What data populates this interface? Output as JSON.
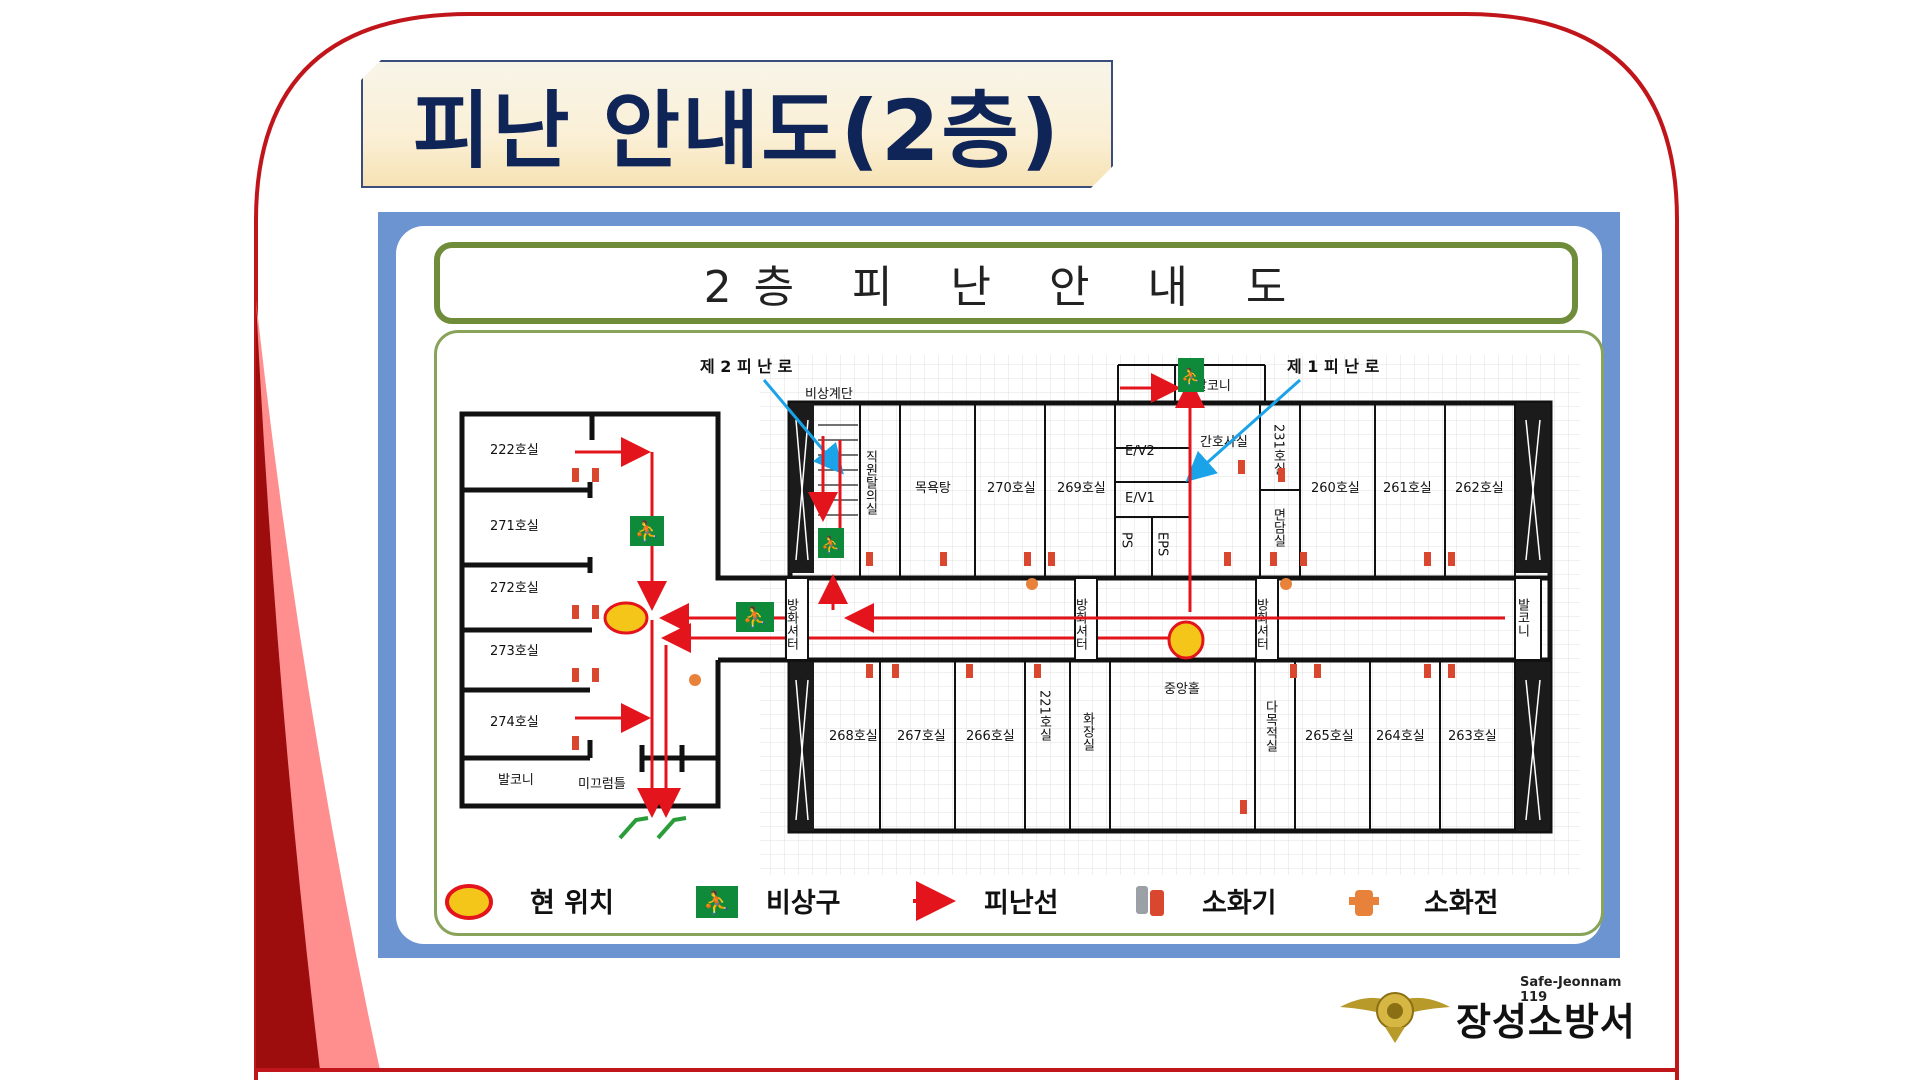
{
  "slide": {
    "title": "피난 안내도(2층)",
    "colors": {
      "frame": "#c0161b",
      "ribbon_dark": "#9e0d0d",
      "ribbon_light": "#ff8f8f",
      "panel": "#6b94d1",
      "banner_border": "#6f8c3a"
    }
  },
  "plan": {
    "banner_title": "2층 피 난 안 내 도",
    "route_labels": {
      "second": "제 2 피 난 로",
      "first": "제 1 피 난 로"
    },
    "west_rooms": [
      "222호실",
      "271호실",
      "272호실",
      "273호실",
      "274호실"
    ],
    "west_misc": {
      "balcony": "발코니",
      "slope": "미끄럼틀"
    },
    "stair_label": "비상계단",
    "north_rooms": [
      "직원탈의실",
      "목욕탕",
      "270호실",
      "269호실",
      "E/V2",
      "E/V1",
      "PS",
      "EPS",
      "간호사실",
      "231호실",
      "면담실",
      "260호실",
      "261호실",
      "262호실"
    ],
    "south_rooms": [
      "268호실",
      "267호실",
      "266호실",
      "221호실",
      "화장실",
      "중앙홀",
      "다목적실",
      "265호실",
      "264호실",
      "263호실"
    ],
    "fire_shutter": "방화셔터",
    "balcony_top": "발코니",
    "balcony_east": "발코니"
  },
  "legend": [
    {
      "label": "현 위치",
      "icon": "current-location-icon"
    },
    {
      "label": "비상구",
      "icon": "emergency-exit-icon"
    },
    {
      "label": "피난선",
      "icon": "evacuation-arrow-icon"
    },
    {
      "label": "소화기",
      "icon": "fire-extinguisher-icon"
    },
    {
      "label": "소화전",
      "icon": "fire-hydrant-icon"
    }
  ],
  "brand": {
    "sub": "Safe-Jeonnam 119",
    "name": "장성소방서"
  }
}
